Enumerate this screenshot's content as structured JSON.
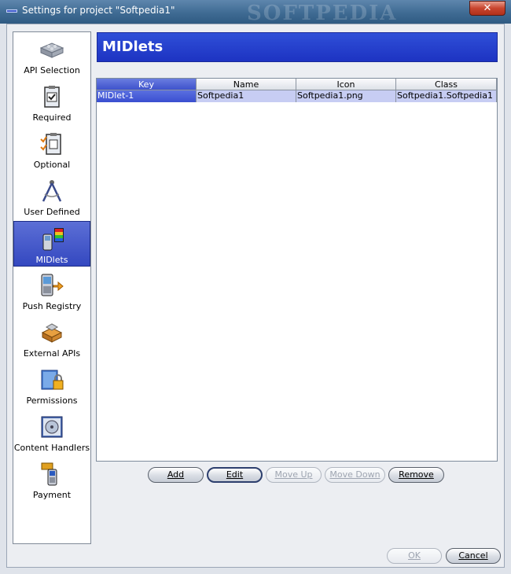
{
  "window": {
    "title": "Settings for project \"Softpedia1\"",
    "close_label": "✕",
    "watermark": "SOFTPEDIA"
  },
  "sidebar": {
    "items": [
      {
        "label": "API Selection",
        "icon": "api-bricks-icon"
      },
      {
        "label": "Required",
        "icon": "clipboard-check-icon"
      },
      {
        "label": "Optional",
        "icon": "checklist-icon"
      },
      {
        "label": "User Defined",
        "icon": "compass-icon"
      },
      {
        "label": "MIDlets",
        "icon": "phone-midlets-icon",
        "selected": true
      },
      {
        "label": "Push Registry",
        "icon": "phone-plug-icon"
      },
      {
        "label": "External APIs",
        "icon": "bricks-icon"
      },
      {
        "label": "Permissions",
        "icon": "lock-folder-icon"
      },
      {
        "label": "Content Handlers",
        "icon": "disc-box-icon"
      },
      {
        "label": "Payment",
        "icon": "phone-payment-icon"
      }
    ]
  },
  "header": {
    "title": "MIDlets"
  },
  "table": {
    "columns": [
      "Key",
      "Name",
      "Icon",
      "Class"
    ],
    "rows": [
      [
        "MIDlet-1",
        "Softpedia1",
        "Softpedia1.png",
        "Softpedia1.Softpedia1"
      ]
    ]
  },
  "buttons": {
    "add": "Add",
    "edit": "Edit",
    "move_up": "Move Up",
    "move_down": "Move Down",
    "remove": "Remove",
    "ok": "OK",
    "cancel": "Cancel"
  },
  "colors": {
    "accent": "#2f4fd8",
    "selection": "#3a4fd0",
    "titlebar": "#3f6b93"
  }
}
